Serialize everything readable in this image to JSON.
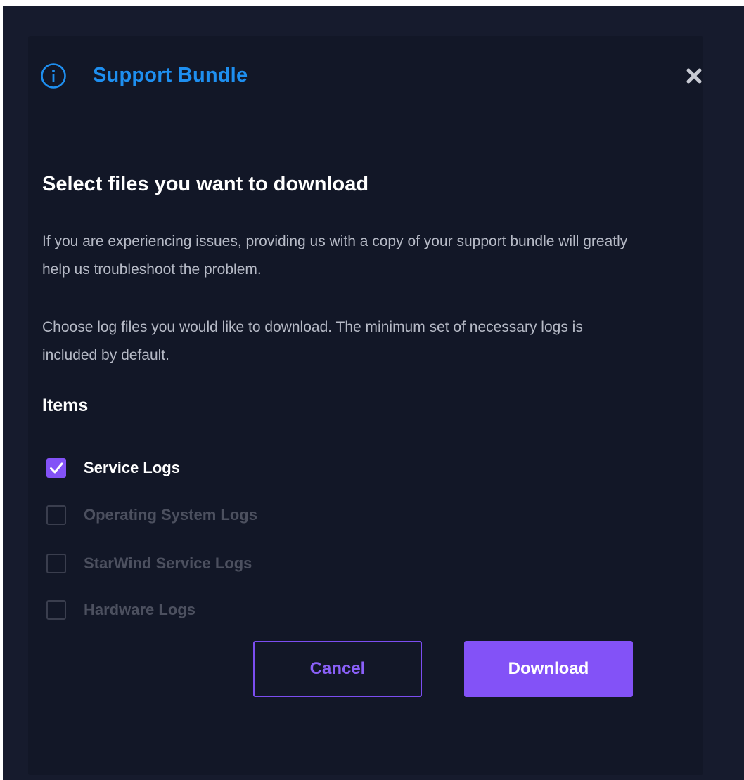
{
  "dialog": {
    "title": "Support Bundle",
    "heading": "Select files you want to download",
    "paragraph1": "If you are experiencing issues, providing us with a copy of your support bundle will greatly help us troubleshoot the problem.",
    "paragraph2": "Choose log files you would like to download. The minimum set of necessary logs is included by default.",
    "items_heading": "Items",
    "items": [
      {
        "label": "Service Logs",
        "checked": true,
        "disabled": false
      },
      {
        "label": "Operating System Logs",
        "checked": false,
        "disabled": true
      },
      {
        "label": "StarWind Service Logs",
        "checked": false,
        "disabled": true
      },
      {
        "label": "Hardware Logs",
        "checked": false,
        "disabled": true
      }
    ],
    "cancel_label": "Cancel",
    "download_label": "Download"
  },
  "icons": {
    "header": "info-icon",
    "close": "close-icon",
    "check": "checkmark-icon"
  },
  "colors": {
    "backdrop": "#161b2d",
    "dialog_bg": "#121727",
    "title": "#1e8ff0",
    "accent": "#8352f7",
    "body_text": "#b6bac6",
    "disabled_text": "#4c505f"
  }
}
